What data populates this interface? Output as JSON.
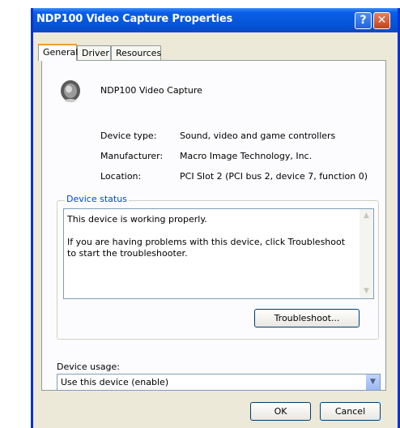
{
  "window": {
    "title": "NDP100 Video Capture Properties",
    "help": "?",
    "close": "✕"
  },
  "tabs": [
    {
      "label": "General"
    },
    {
      "label": "Driver"
    },
    {
      "label": "Resources"
    }
  ],
  "device": {
    "name": "NDP100 Video Capture",
    "icon": "speaker-icon",
    "properties": [
      {
        "label": "Device type:",
        "value": "Sound, video and game controllers"
      },
      {
        "label": "Manufacturer:",
        "value": "Macro Image Technology, Inc."
      },
      {
        "label": "Location:",
        "value": "PCI Slot 2 (PCI bus 2, device 7, function 0)"
      }
    ]
  },
  "status": {
    "group_label": "Device status",
    "line1": "This device is working properly.",
    "line2": "If you are having problems with this device, click Troubleshoot to start the troubleshooter.",
    "troubleshoot_label": "Troubleshoot..."
  },
  "usage": {
    "label": "Device usage:",
    "selected": "Use this device (enable)"
  },
  "buttons": {
    "ok": "OK",
    "cancel": "Cancel"
  },
  "colors": {
    "title_bar": "#0654d6",
    "group_title": "#0046d5",
    "active_tab_accent": "#f0a028"
  }
}
